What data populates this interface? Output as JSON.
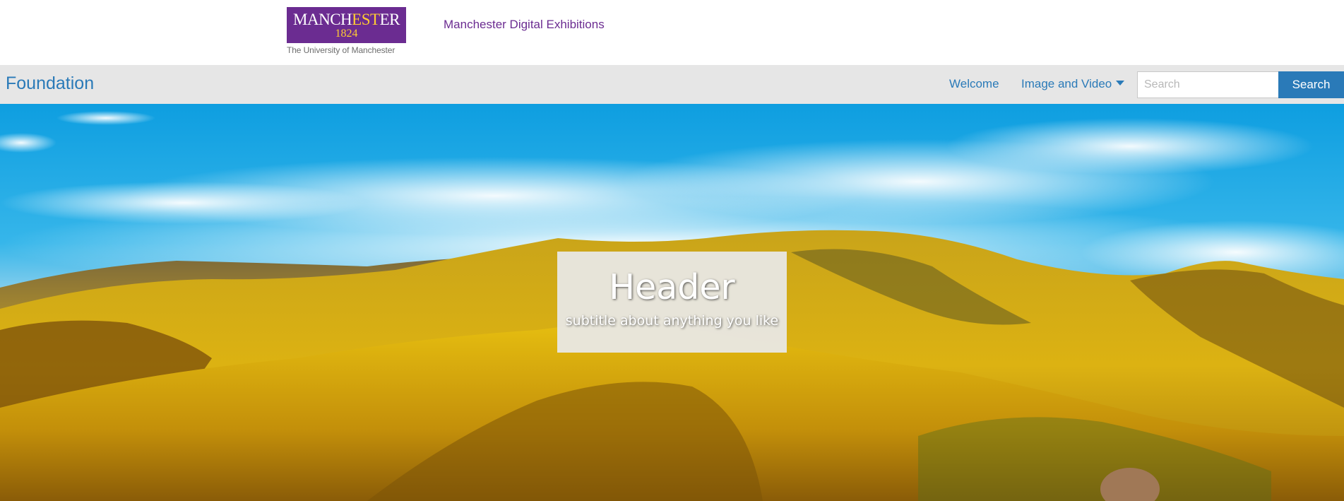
{
  "university": {
    "logo_name_start": "MANCH",
    "logo_name_gold": "EST",
    "logo_name_end": "ER",
    "logo_year": "1824",
    "logo_subtitle": "The University of Manchester",
    "site_link": "Manchester Digital Exhibitions"
  },
  "nav": {
    "brand": "Foundation",
    "items": [
      {
        "label": "Welcome"
      },
      {
        "label": "Image and Video",
        "has_dropdown": true
      }
    ],
    "search": {
      "placeholder": "Search",
      "value": "",
      "button_label": "Search"
    }
  },
  "hero": {
    "title": "Header",
    "subtitle": "subtitle about anything you like",
    "image": "landscape-hills-sky"
  },
  "colors": {
    "brand_purple": "#6b2c91",
    "logo_gold": "#ffcc33",
    "link_blue": "#2a7ab8",
    "nav_bg": "#e6e6e6"
  }
}
